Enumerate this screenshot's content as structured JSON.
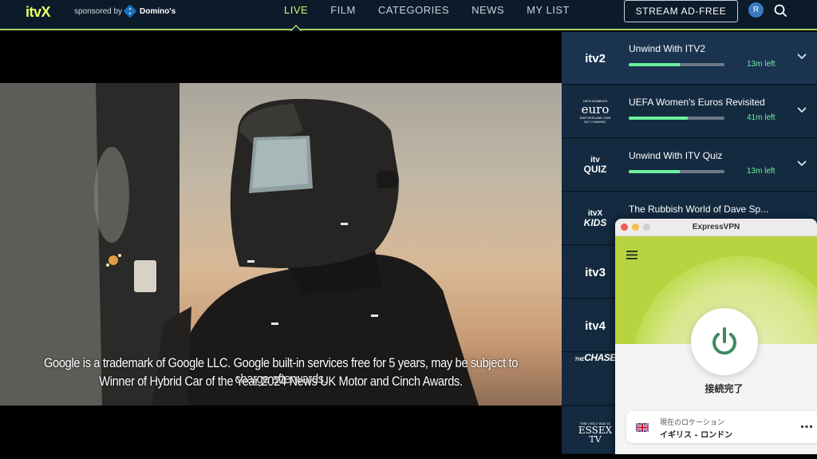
{
  "header": {
    "logo": "itvX",
    "sponsor_text": "sponsored by",
    "sponsor_brand": "Domino's",
    "nav": [
      {
        "label": "LIVE",
        "active": true
      },
      {
        "label": "FILM",
        "active": false
      },
      {
        "label": "CATEGORIES",
        "active": false
      },
      {
        "label": "NEWS",
        "active": false
      },
      {
        "label": "MY LIST",
        "active": false
      }
    ],
    "stream_button": "STREAM AD-FREE",
    "avatar_initial": "R",
    "accent": "#d9f56b"
  },
  "video": {
    "subtitle_line1": "Google is a trademark of Google LLC. Google built-in services free for 5 years, may be subject to charge afterwards.",
    "subtitle_line2": "Winner of Hybrid Car of the Year 2024 News UK Motor and Cinch Awards."
  },
  "channels": [
    {
      "logo": "itv2",
      "title": "Unwind With ITV2",
      "progress": 0.53,
      "time_left": "13m left"
    },
    {
      "logo": "euro",
      "logo_lines": [
        "UEFA WOMEN'S",
        "euro",
        "SWITZERLAND 2025",
        "24/7 CHANNEL"
      ],
      "title": "UEFA Women's Euros Revisited",
      "progress": 0.62,
      "time_left": "41m left"
    },
    {
      "logo": "itv quiz",
      "logo_lines": [
        "itv",
        "QUIZ"
      ],
      "title": "Unwind With ITV Quiz",
      "progress": 0.53,
      "time_left": "13m left"
    },
    {
      "logo": "itvX kids",
      "logo_lines": [
        "itvX",
        "KIDS"
      ],
      "title": "The Rubbish World of Dave Sp...",
      "progress": null,
      "time_left": null
    },
    {
      "logo": "itv3",
      "title": null
    },
    {
      "logo": "itv4",
      "title": null
    },
    {
      "logo": "CHASE",
      "logo_lines": [
        "THE",
        "CHASE"
      ],
      "title": null
    },
    {
      "logo": "ESSEX TV",
      "logo_lines": [
        "THE ONLY WAY IS",
        "ESSEX",
        "TV"
      ],
      "title": null
    }
  ],
  "vpn": {
    "window_title": "ExpressVPN",
    "status": "接続完了",
    "location_label": "現在のロケーション",
    "location_name": "イギリス - ロンドン",
    "brand_green": "#b7d33f",
    "power_color": "#3f8a63"
  }
}
